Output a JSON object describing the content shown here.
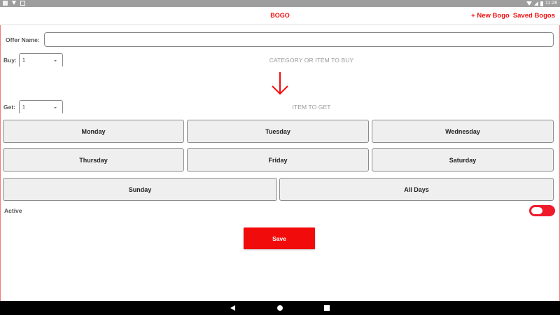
{
  "status_bar": {
    "time": "11:28",
    "left_icons": [
      "notification-icon",
      "download-icon",
      "crop-icon"
    ],
    "right_icons": [
      "wifi-icon",
      "signal-icon",
      "battery-icon"
    ]
  },
  "app_bar": {
    "title": "BOGO",
    "new_label": "+ New Bogo",
    "saved_label": "Saved Bogos",
    "accent_color": "#ef1010"
  },
  "form": {
    "offer_name_label": "Offer Name:",
    "offer_name_value": "",
    "buy_label": "Buy:",
    "buy_value": "1",
    "buy_hint": "CATEGORY OR ITEM TO BUY",
    "get_label": "Get:",
    "get_value": "1",
    "get_hint": "ITEM TO GET",
    "arrow_icon": "arrow-down-icon",
    "arrow_color": "#f20b0b"
  },
  "days": [
    {
      "label": "Monday"
    },
    {
      "label": "Tuesday"
    },
    {
      "label": "Wednesday"
    },
    {
      "label": "Thursday"
    },
    {
      "label": "Friday"
    },
    {
      "label": "Saturday"
    },
    {
      "label": "Sunday"
    },
    {
      "label": "All Days"
    }
  ],
  "active": {
    "label": "Active",
    "state": "off",
    "color": "#ef1a2a"
  },
  "save_label": "Save",
  "nav_icons": [
    "back-icon",
    "home-icon",
    "recent-apps-icon"
  ]
}
